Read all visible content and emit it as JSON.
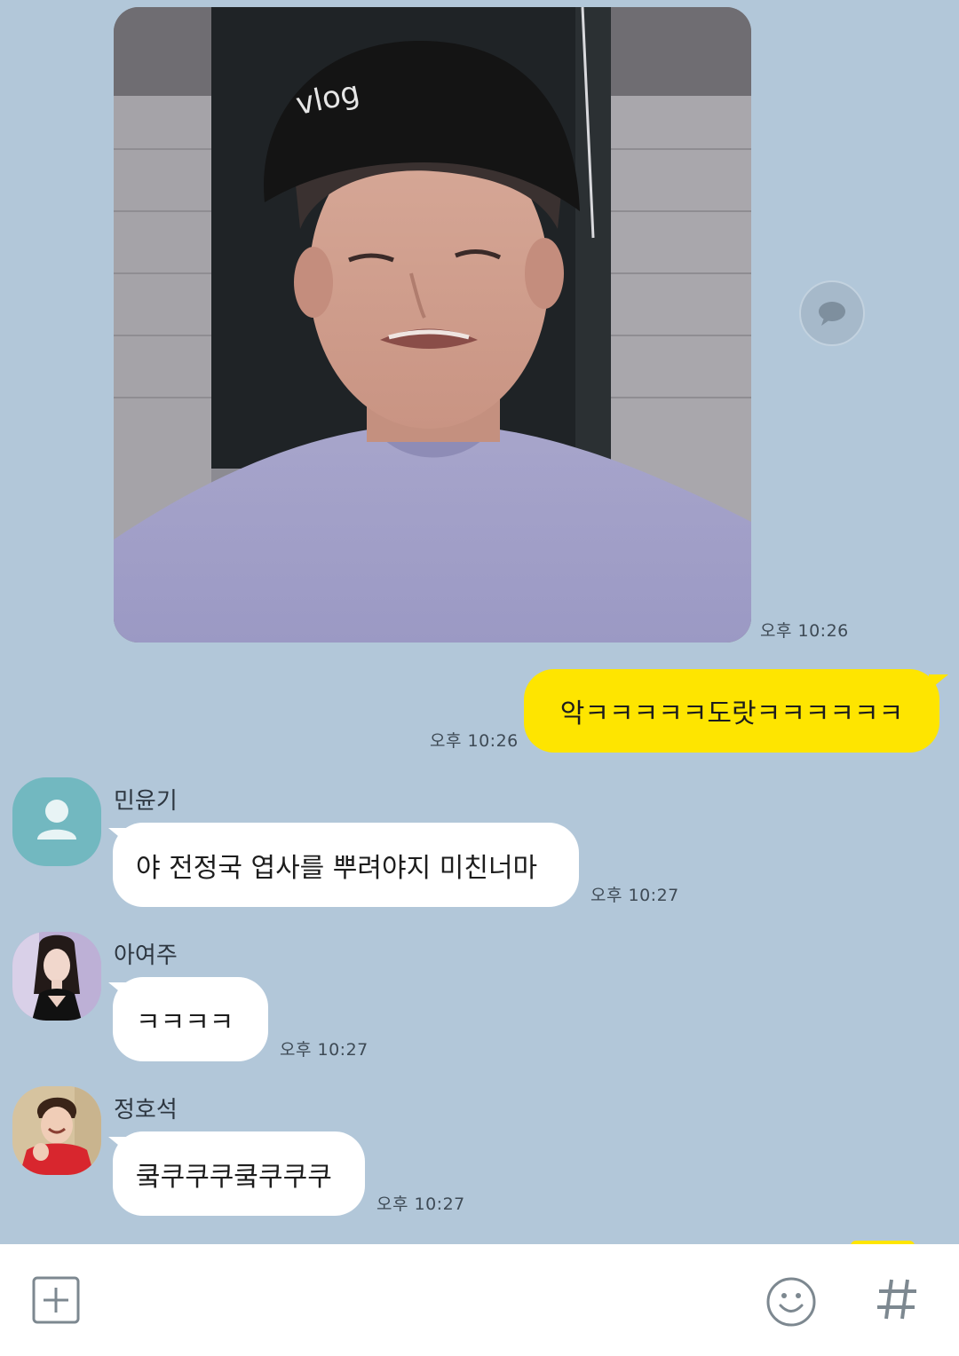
{
  "messages": [
    {
      "type": "photo",
      "from": "me",
      "time": "오후 10:26"
    },
    {
      "type": "text",
      "from": "me",
      "text": "악ㅋㅋㅋㅋㅋ도랏ㅋㅋㅋㅋㅋㅋ",
      "time": "오후 10:26"
    },
    {
      "type": "text",
      "from": "민윤기",
      "text": "야 전정국 엽사를 뿌려야지 미친너마",
      "time": "오후 10:27"
    },
    {
      "type": "text",
      "from": "아여주",
      "text": "ㅋㅋㅋㅋ",
      "time": "오후 10:27"
    },
    {
      "type": "text",
      "from": "정호석",
      "text": "쿸쿠쿠쿠쿸쿠쿠쿠",
      "time": "오후 10:27"
    }
  ],
  "icons": {
    "share": "speech-bubble-icon",
    "add": "plus-square-icon",
    "emoji": "smiley-icon",
    "hashtag": "hash-icon",
    "default_avatar": "person-icon"
  },
  "colors": {
    "background": "#b2c7d9",
    "my_bubble": "#fee500",
    "other_bubble": "#ffffff",
    "default_avatar": "#72b8c0"
  }
}
